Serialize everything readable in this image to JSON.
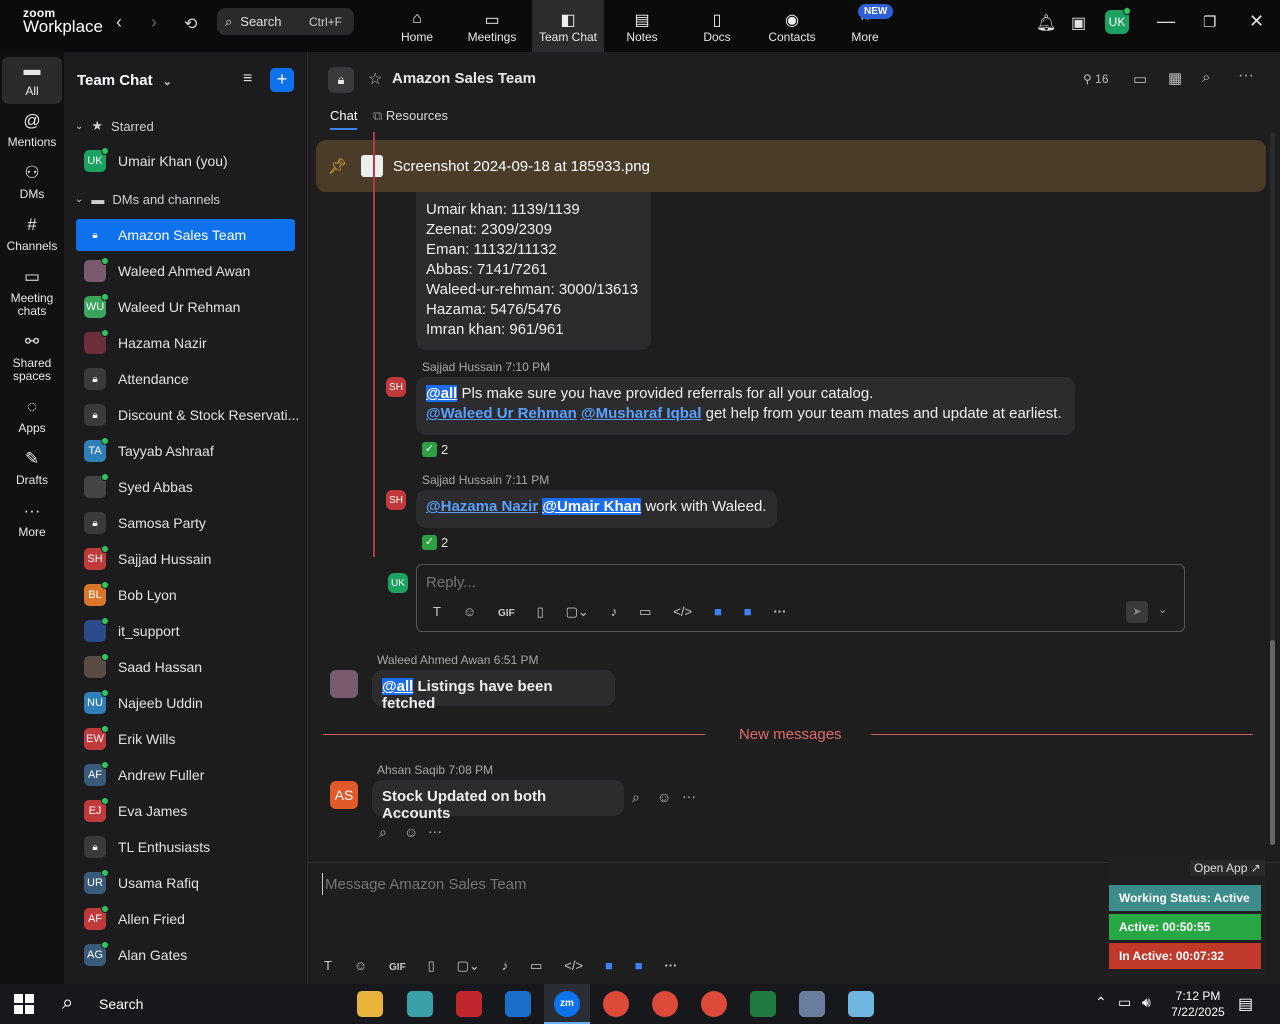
{
  "app": {
    "brand_small": "zoom",
    "brand_big": "Workplace"
  },
  "search": {
    "label": "Search",
    "shortcut": "Ctrl+F"
  },
  "top_tabs": [
    {
      "label": "Home",
      "icon": "home-icon"
    },
    {
      "label": "Meetings",
      "icon": "camera-icon"
    },
    {
      "label": "Team Chat",
      "icon": "chat-icon"
    },
    {
      "label": "Notes",
      "icon": "notes-icon"
    },
    {
      "label": "Docs",
      "icon": "docs-icon"
    },
    {
      "label": "Contacts",
      "icon": "contacts-icon"
    },
    {
      "label": "More",
      "icon": "more-icon"
    }
  ],
  "new_badge": "NEW",
  "user_initials": "UK",
  "rail": [
    {
      "label": "All",
      "icon": "chat-icon"
    },
    {
      "label": "Mentions",
      "icon": "at-icon"
    },
    {
      "label": "DMs",
      "icon": "people-icon"
    },
    {
      "label": "Channels",
      "icon": "hash-icon"
    },
    {
      "label": "Meeting chats",
      "icon": "calendar-icon"
    },
    {
      "label": "Shared spaces",
      "icon": "share-icon"
    },
    {
      "label": "Apps",
      "icon": "apps-icon"
    },
    {
      "label": "Drafts",
      "icon": "drafts-icon"
    },
    {
      "label": "More",
      "icon": "more-icon"
    }
  ],
  "sidebar": {
    "title": "Team Chat",
    "starred_label": "Starred",
    "dms_label": "DMs and channels",
    "starred": [
      {
        "name": "Umair Khan (you)",
        "initials": "UK",
        "color": "#1ba160"
      }
    ],
    "items": [
      {
        "name": "Amazon Sales Team",
        "initials": "",
        "color": "",
        "lock": true,
        "selected": true
      },
      {
        "name": "Waleed Ahmed Awan",
        "initials": "",
        "color": "#7a5a6e",
        "lock": false
      },
      {
        "name": "Waleed Ur Rehman",
        "initials": "WU",
        "color": "#3aa35c",
        "lock": false
      },
      {
        "name": "Hazama Nazir",
        "initials": "",
        "color": "#6b2e3a",
        "lock": false
      },
      {
        "name": "Attendance",
        "initials": "",
        "color": "",
        "lock": true
      },
      {
        "name": "Discount & Stock Reservati...",
        "initials": "",
        "color": "",
        "lock": true
      },
      {
        "name": "Tayyab Ashraaf",
        "initials": "TA",
        "color": "#2f7fb8",
        "lock": false
      },
      {
        "name": "Syed Abbas",
        "initials": "",
        "color": "#444",
        "lock": false
      },
      {
        "name": "Samosa Party",
        "initials": "",
        "color": "",
        "lock": true
      },
      {
        "name": "Sajjad Hussain",
        "initials": "SH",
        "color": "#c0393b",
        "lock": false
      },
      {
        "name": "Bob Lyon",
        "initials": "BL",
        "color": "#d9762b",
        "lock": false
      },
      {
        "name": "it_support",
        "initials": "",
        "color": "#2b4a8a",
        "lock": false
      },
      {
        "name": "Saad Hassan",
        "initials": "",
        "color": "#5a4a44",
        "lock": false
      },
      {
        "name": "Najeeb Uddin",
        "initials": "NU",
        "color": "#2f7fb8",
        "lock": false
      },
      {
        "name": "Erik Wills",
        "initials": "EW",
        "color": "#c0393b",
        "lock": false
      },
      {
        "name": "Andrew Fuller",
        "initials": "AF",
        "color": "#3a5a7a",
        "lock": false
      },
      {
        "name": "Eva James",
        "initials": "EJ",
        "color": "#c0393b",
        "lock": false
      },
      {
        "name": "TL Enthusiasts",
        "initials": "",
        "color": "",
        "lock": true
      },
      {
        "name": "Usama Rafiq",
        "initials": "UR",
        "color": "#3a5a7a",
        "lock": false
      },
      {
        "name": "Allen Fried",
        "initials": "AF",
        "color": "#c0393b",
        "lock": false
      },
      {
        "name": "Alan Gates",
        "initials": "AG",
        "color": "#3a5a7a",
        "lock": false
      }
    ]
  },
  "channel": {
    "title": "Amazon Sales Team",
    "member_count": "16",
    "tabs": [
      "Chat",
      "Resources"
    ]
  },
  "pinned": {
    "filename": "Screenshot 2024-09-18 at 185933.png"
  },
  "stats_lines": [
    "Umair khan: 1139/1139",
    "Zeenat: 2309/2309",
    "Eman: 11132/11132",
    "Abbas: 7141/7261",
    "Waleed-ur-rehman: 3000/13613",
    "Hazama: 5476/5476",
    "Imran khan: 961/961"
  ],
  "thread": [
    {
      "sender": "Sajjad Hussain",
      "time": "7:10 PM",
      "initials": "SH",
      "line1_mention": "@all",
      "line1_text": " Pls make sure you have provided referrals for all your catalog.",
      "line2_mention_a": "@Waleed Ur Rehman",
      "line2_mention_b": "@Musharaf Iqbal",
      "line2_text": " get help from your team mates and update at earliest.",
      "reaction_count": "2"
    },
    {
      "sender": "Sajjad Hussain",
      "time": "7:11 PM",
      "initials": "SH",
      "mention_a": "@Hazama Nazir",
      "mention_b": "@Umair Khan",
      "text": " work with Waleed.",
      "reaction_count": "2"
    }
  ],
  "reply": {
    "placeholder": "Reply..."
  },
  "waleed_msg": {
    "sender": "Waleed Ahmed Awan",
    "time": "6:51 PM",
    "mention": "@all",
    "text": " Listings have been fetched"
  },
  "new_messages_label": "New messages",
  "ahsan_msg": {
    "sender": "Ahsan Saqib",
    "time": "7:08 PM",
    "initials": "AS",
    "text": "Stock Updated on both Accounts"
  },
  "composer": {
    "placeholder": "Message Amazon Sales Team"
  },
  "toolbar": {
    "gif": "GIF"
  },
  "status_widget": {
    "open_app": "Open App ↗",
    "working": "Working Status: Active",
    "active": "Active: 00:50:55",
    "inactive": "In Active: 00:07:32",
    "colors": {
      "working": "#3d8c8c",
      "active": "#28a745",
      "inactive": "#c0392b"
    }
  },
  "taskbar": {
    "search": "Search",
    "time": "7:12 PM",
    "date": "7/22/2025"
  }
}
